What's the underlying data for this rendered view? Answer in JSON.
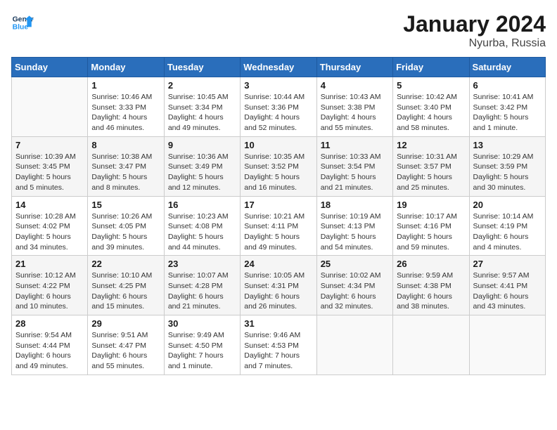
{
  "header": {
    "logo_line1": "General",
    "logo_line2": "Blue",
    "month": "January 2024",
    "location": "Nyurba, Russia"
  },
  "weekdays": [
    "Sunday",
    "Monday",
    "Tuesday",
    "Wednesday",
    "Thursday",
    "Friday",
    "Saturday"
  ],
  "weeks": [
    [
      {
        "day": "",
        "info": ""
      },
      {
        "day": "1",
        "info": "Sunrise: 10:46 AM\nSunset: 3:33 PM\nDaylight: 4 hours\nand 46 minutes."
      },
      {
        "day": "2",
        "info": "Sunrise: 10:45 AM\nSunset: 3:34 PM\nDaylight: 4 hours\nand 49 minutes."
      },
      {
        "day": "3",
        "info": "Sunrise: 10:44 AM\nSunset: 3:36 PM\nDaylight: 4 hours\nand 52 minutes."
      },
      {
        "day": "4",
        "info": "Sunrise: 10:43 AM\nSunset: 3:38 PM\nDaylight: 4 hours\nand 55 minutes."
      },
      {
        "day": "5",
        "info": "Sunrise: 10:42 AM\nSunset: 3:40 PM\nDaylight: 4 hours\nand 58 minutes."
      },
      {
        "day": "6",
        "info": "Sunrise: 10:41 AM\nSunset: 3:42 PM\nDaylight: 5 hours\nand 1 minute."
      }
    ],
    [
      {
        "day": "7",
        "info": "Sunrise: 10:39 AM\nSunset: 3:45 PM\nDaylight: 5 hours\nand 5 minutes."
      },
      {
        "day": "8",
        "info": "Sunrise: 10:38 AM\nSunset: 3:47 PM\nDaylight: 5 hours\nand 8 minutes."
      },
      {
        "day": "9",
        "info": "Sunrise: 10:36 AM\nSunset: 3:49 PM\nDaylight: 5 hours\nand 12 minutes."
      },
      {
        "day": "10",
        "info": "Sunrise: 10:35 AM\nSunset: 3:52 PM\nDaylight: 5 hours\nand 16 minutes."
      },
      {
        "day": "11",
        "info": "Sunrise: 10:33 AM\nSunset: 3:54 PM\nDaylight: 5 hours\nand 21 minutes."
      },
      {
        "day": "12",
        "info": "Sunrise: 10:31 AM\nSunset: 3:57 PM\nDaylight: 5 hours\nand 25 minutes."
      },
      {
        "day": "13",
        "info": "Sunrise: 10:29 AM\nSunset: 3:59 PM\nDaylight: 5 hours\nand 30 minutes."
      }
    ],
    [
      {
        "day": "14",
        "info": "Sunrise: 10:28 AM\nSunset: 4:02 PM\nDaylight: 5 hours\nand 34 minutes."
      },
      {
        "day": "15",
        "info": "Sunrise: 10:26 AM\nSunset: 4:05 PM\nDaylight: 5 hours\nand 39 minutes."
      },
      {
        "day": "16",
        "info": "Sunrise: 10:23 AM\nSunset: 4:08 PM\nDaylight: 5 hours\nand 44 minutes."
      },
      {
        "day": "17",
        "info": "Sunrise: 10:21 AM\nSunset: 4:11 PM\nDaylight: 5 hours\nand 49 minutes."
      },
      {
        "day": "18",
        "info": "Sunrise: 10:19 AM\nSunset: 4:13 PM\nDaylight: 5 hours\nand 54 minutes."
      },
      {
        "day": "19",
        "info": "Sunrise: 10:17 AM\nSunset: 4:16 PM\nDaylight: 5 hours\nand 59 minutes."
      },
      {
        "day": "20",
        "info": "Sunrise: 10:14 AM\nSunset: 4:19 PM\nDaylight: 6 hours\nand 4 minutes."
      }
    ],
    [
      {
        "day": "21",
        "info": "Sunrise: 10:12 AM\nSunset: 4:22 PM\nDaylight: 6 hours\nand 10 minutes."
      },
      {
        "day": "22",
        "info": "Sunrise: 10:10 AM\nSunset: 4:25 PM\nDaylight: 6 hours\nand 15 minutes."
      },
      {
        "day": "23",
        "info": "Sunrise: 10:07 AM\nSunset: 4:28 PM\nDaylight: 6 hours\nand 21 minutes."
      },
      {
        "day": "24",
        "info": "Sunrise: 10:05 AM\nSunset: 4:31 PM\nDaylight: 6 hours\nand 26 minutes."
      },
      {
        "day": "25",
        "info": "Sunrise: 10:02 AM\nSunset: 4:34 PM\nDaylight: 6 hours\nand 32 minutes."
      },
      {
        "day": "26",
        "info": "Sunrise: 9:59 AM\nSunset: 4:38 PM\nDaylight: 6 hours\nand 38 minutes."
      },
      {
        "day": "27",
        "info": "Sunrise: 9:57 AM\nSunset: 4:41 PM\nDaylight: 6 hours\nand 43 minutes."
      }
    ],
    [
      {
        "day": "28",
        "info": "Sunrise: 9:54 AM\nSunset: 4:44 PM\nDaylight: 6 hours\nand 49 minutes."
      },
      {
        "day": "29",
        "info": "Sunrise: 9:51 AM\nSunset: 4:47 PM\nDaylight: 6 hours\nand 55 minutes."
      },
      {
        "day": "30",
        "info": "Sunrise: 9:49 AM\nSunset: 4:50 PM\nDaylight: 7 hours\nand 1 minute."
      },
      {
        "day": "31",
        "info": "Sunrise: 9:46 AM\nSunset: 4:53 PM\nDaylight: 7 hours\nand 7 minutes."
      },
      {
        "day": "",
        "info": ""
      },
      {
        "day": "",
        "info": ""
      },
      {
        "day": "",
        "info": ""
      }
    ]
  ]
}
